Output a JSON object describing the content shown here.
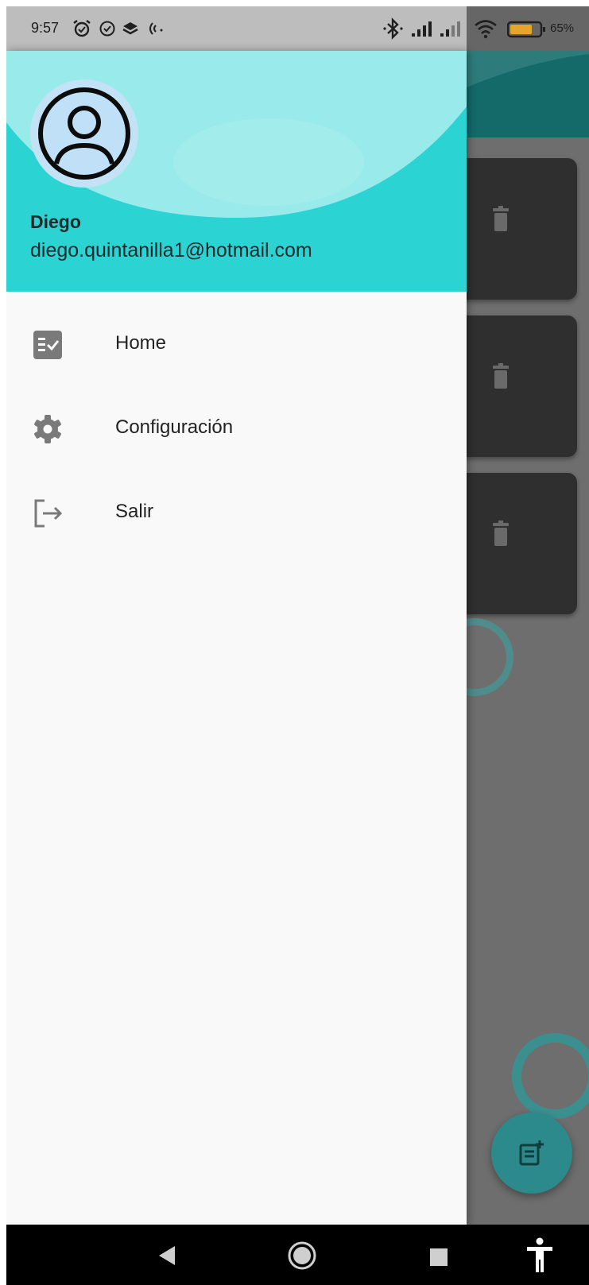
{
  "status_bar": {
    "time": "9:57",
    "battery_percent": "65%",
    "icons": [
      "alarm-icon",
      "check-circle-icon",
      "layers-icon",
      "nfc-icon",
      "bluetooth-icon",
      "signal-icon",
      "signal-icon-2",
      "wifi-icon",
      "battery-icon"
    ]
  },
  "drawer": {
    "header": {
      "avatar_icon": "account-circle-icon",
      "user_name": "Diego",
      "user_email": "diego.quintanilla1@hotmail.com"
    },
    "items": [
      {
        "label": "Home",
        "icon": "task-list-icon"
      },
      {
        "label": "Configuración",
        "icon": "gear-icon"
      },
      {
        "label": "Salir",
        "icon": "logout-icon"
      }
    ]
  },
  "background": {
    "cards": [
      {
        "icon": "trash-icon"
      },
      {
        "icon": "trash-icon"
      },
      {
        "icon": "trash-icon"
      }
    ],
    "fab_icon": "add-note-icon"
  },
  "nav_bar": {
    "buttons": [
      "back-icon",
      "home-icon",
      "recents-icon",
      "accessibility-icon"
    ]
  },
  "colors": {
    "drawer_header": "#2bd3d3",
    "drawer_bg": "#f9f9f9",
    "scrim": "#6e6e6e",
    "app_bar": "#136a69",
    "card": "#2f2f2f",
    "fab": "#2c8a8c"
  }
}
